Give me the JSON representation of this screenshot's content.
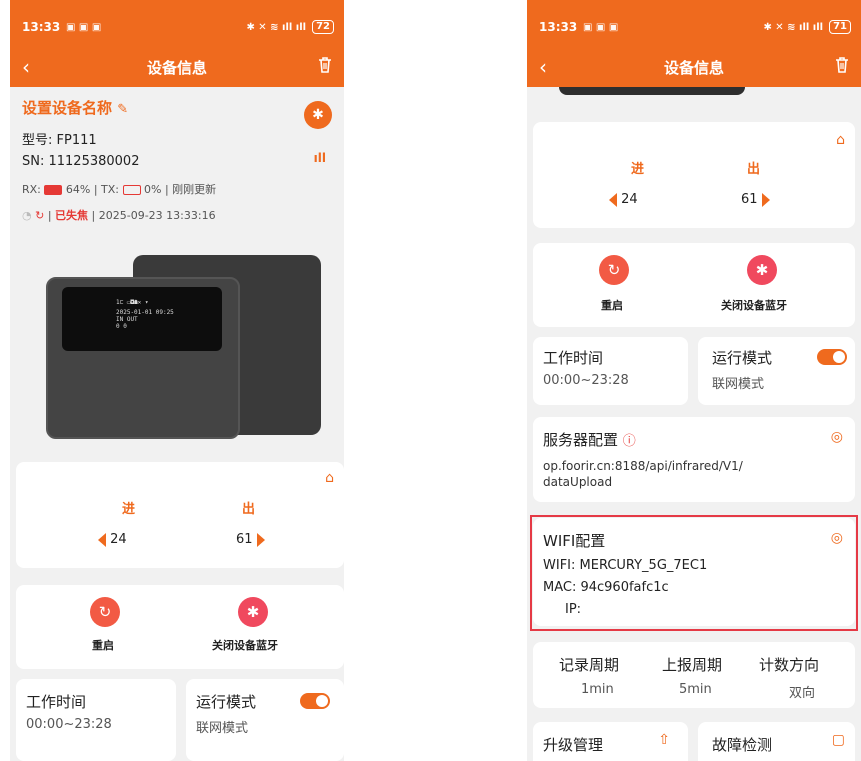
{
  "status": {
    "time": "13:33",
    "battery_left": "72",
    "battery_right": "71",
    "signal": "𝄃 .ıll .ıll"
  },
  "nav": {
    "title": "设备信息",
    "back_icon": "‹"
  },
  "device": {
    "name": "设置设备名称",
    "model": "型号: FP111",
    "sn": "SN: 11125380002",
    "rx_label": "RX:",
    "rx_value": "64%",
    "tx_label": "| TX:",
    "tx_value": "0%",
    "updated": "| 刚刚更新",
    "sep": "|",
    "focus_status": "已失焦",
    "timestamp": "| 2025-09-23 13:33:16",
    "screen_text_top": "1⊏ ▭◘☗✕  ▾",
    "screen_text_date": "2025-01-01 09:25",
    "screen_text_inout": "IN        OUT",
    "screen_text_counts": "0           0"
  },
  "counts": {
    "in_label": "进",
    "out_label": "出",
    "in_value": "24",
    "out_value": "61"
  },
  "actions": {
    "restart": "重启",
    "close_bt": "关闭设备蓝牙"
  },
  "work": {
    "time_label": "工作时间",
    "time_value": "00:00~23:28",
    "mode_label": "运行模式",
    "mode_value": "联网模式"
  },
  "server": {
    "label": "服务器配置",
    "url_line1": "op.foorir.cn:8188/api/infrared/V1/",
    "url_line2": "dataUpload"
  },
  "wifi": {
    "label": "WIFI配置",
    "wifi": "WIFI: MERCURY_5G_7EC1",
    "mac": "MAC: 94c960fafc1c",
    "ip": "IP:"
  },
  "periods": {
    "record_label": "记录周期",
    "record_value": "1min",
    "report_label": "上报周期",
    "report_value": "5min",
    "direction_label": "计数方向",
    "direction_value": "双向"
  },
  "bottom": {
    "upgrade": "升级管理",
    "fault": "故障检测"
  },
  "colors": {
    "accent": "#ef6a1e",
    "danger": "#e53935",
    "highlight_border": "#e53945"
  }
}
